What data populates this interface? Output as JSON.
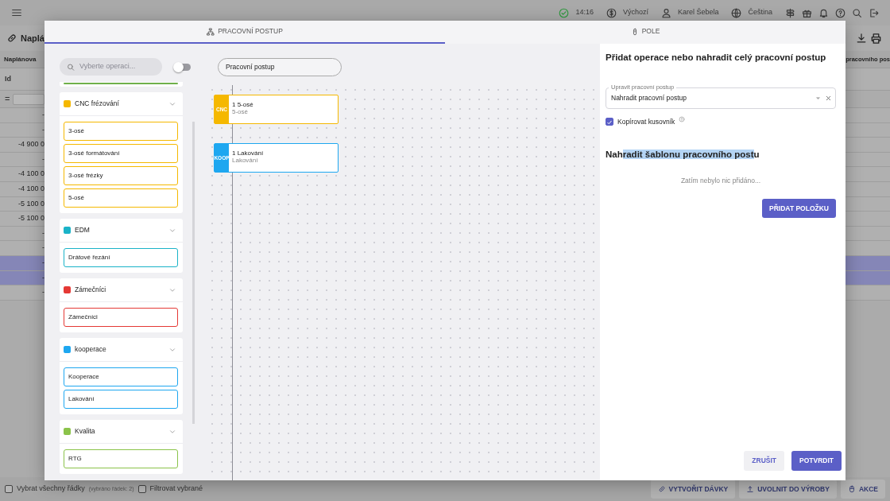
{
  "topbar": {
    "time": "14:16",
    "profile": "Výchozí",
    "user": "Karel Šebela",
    "language": "Čeština"
  },
  "page": {
    "title": "Naplá",
    "column_header": "Naplánova",
    "right_header": "pracovního pos",
    "id_header": "Id",
    "filter_operator": "="
  },
  "rows": [
    {
      "value": "-",
      "selected": false
    },
    {
      "value": "-",
      "selected": false
    },
    {
      "value": "-4 900 0",
      "selected": false
    },
    {
      "value": "-",
      "selected": false
    },
    {
      "value": "-4 100 0",
      "selected": false
    },
    {
      "value": "-4 100 0",
      "selected": false
    },
    {
      "value": "-5 100 0",
      "selected": false
    },
    {
      "value": "-5 100 0",
      "selected": false
    },
    {
      "value": "-",
      "selected": false
    },
    {
      "value": "-",
      "selected": false
    },
    {
      "value": "-",
      "selected": true
    },
    {
      "value": "-",
      "selected": true
    },
    {
      "value": "-",
      "selected": false
    }
  ],
  "bottom_bar": {
    "select_all": {
      "label": "Vybrat všechny řádky",
      "checked": false
    },
    "selected_count": "(vybráno řádek: 2)",
    "filter_selected": {
      "label": "Filtrovat vybrané",
      "checked": false
    },
    "buttons": [
      "VYTVOŘIT DÁVKY",
      "UVOLNIT DO VÝROBY",
      "AKCE"
    ]
  },
  "dialog": {
    "tabs": [
      {
        "label": "PRACOVNÍ POSTUP",
        "selected": true
      },
      {
        "label": "POLE",
        "selected": false
      }
    ],
    "search": {
      "placeholder": "Vyberte operaci..."
    },
    "toggle": {
      "on": false
    },
    "workflow_name": "Pracovní postup",
    "palette": [
      {
        "kind": "cut",
        "color": "#6fb04a"
      },
      {
        "kind": "group",
        "name": "CNC frézování",
        "color": "#f5b800",
        "expanded": true,
        "items": [
          "3-osé",
          "3-osé formátování",
          "3-osé frézky",
          "5-osé"
        ]
      },
      {
        "kind": "group",
        "name": "EDM",
        "color": "#1ab3c8",
        "expanded": true,
        "items": [
          "Drátové řezání"
        ]
      },
      {
        "kind": "group",
        "name": "Zámečníci",
        "color": "#e53935",
        "expanded": true,
        "items": [
          "Zámečníci"
        ]
      },
      {
        "kind": "group",
        "name": "kooperace",
        "color": "#1ea7f0",
        "expanded": true,
        "items": [
          "Kooperace",
          "Lakování"
        ]
      },
      {
        "kind": "group",
        "name": "Kvalita",
        "color": "#8bc34a",
        "expanded": true,
        "items": [
          "RTG"
        ]
      }
    ],
    "nodes": [
      {
        "tag": "CNC",
        "title": "1 5-osé",
        "subtitle": "5-osé",
        "color": "#f5b800"
      },
      {
        "tag": "KOOP",
        "title": "1 Lakování",
        "subtitle": "Lakování",
        "color": "#1ea7f0"
      }
    ],
    "panel": {
      "title": "Přidat operace nebo nahradit celý pracovní postup",
      "select": {
        "label": "Upravit pracovní postup",
        "value": "Nahradit pracovní postup"
      },
      "copy_bom": {
        "label": "Kopírovat kusovník",
        "checked": true
      },
      "template_heading": {
        "before": "Nah",
        "selected": "radit šablonu pracovního post",
        "after": "u"
      },
      "empty_text": "Zatím nebylo nic přidáno...",
      "add_button": "PŘIDAT POLOŽKU"
    },
    "footer": {
      "cancel": "ZRUŠIT",
      "confirm": "POTVRDIT"
    }
  }
}
